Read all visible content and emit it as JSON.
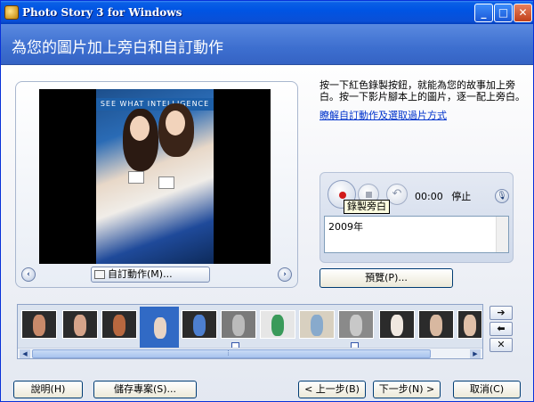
{
  "window": {
    "title": "Photo Story 3 for Windows",
    "minimize": "_",
    "maximize": "□",
    "close": "✕"
  },
  "header": {
    "title": "為您的圖片加上旁白和自訂動作"
  },
  "preview": {
    "prev_symbol": "‹",
    "next_symbol": "›",
    "custom_motion_label": "自訂動作(M)...",
    "banner_text": "SEE WHAT INTELLIGENCE"
  },
  "instructions": {
    "text": "按一下紅色錄製按鈕，就能為您的故事加上旁白。按一下影片腳本上的圖片，逐一配上旁白。",
    "link": "瞭解自訂動作及選取過片方式"
  },
  "narration": {
    "time": "00:00",
    "status": "停止",
    "tooltip": "錄製旁白",
    "text_value": "2009年",
    "undo_symbol": "↶",
    "mic_symbol": "🎙"
  },
  "preview_button": "預覽(P)...",
  "filmstrip": {
    "scroll_left": "◀",
    "scroll_right": "▶",
    "scroll_mid": "⋮"
  },
  "side_buttons": {
    "move_right": "➔",
    "move_left": "⬅",
    "remove": "✕"
  },
  "footer": {
    "help": "說明(H)",
    "save": "儲存專案(S)...",
    "back": "< 上一步(B)",
    "next": "下一步(N) >",
    "cancel": "取消(C)"
  },
  "colors": {
    "titlebar": "#0054e3",
    "header": "#3d6fcf",
    "record_dot": "#d11a1a",
    "selection": "#316ac5"
  }
}
